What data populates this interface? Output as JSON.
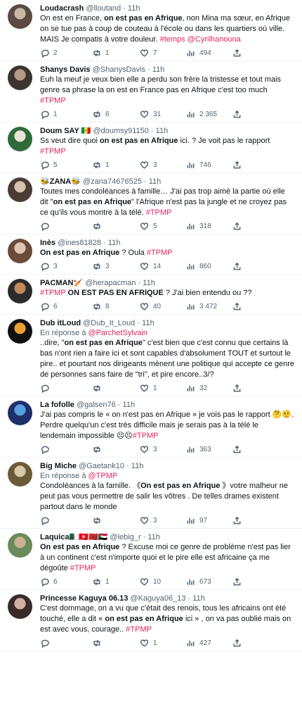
{
  "colors": {
    "hashtag": "#e0245e",
    "meta": "#536471",
    "text": "#0f1419",
    "divider": "#eff3f4"
  },
  "icons": {
    "reply": "speech-bubble-icon",
    "retweet": "retweet-icon",
    "like": "heart-icon",
    "views": "bar-chart-icon",
    "share": "share-icon"
  },
  "tweets": [
    {
      "name": "Loudacrash",
      "meta": "@lloutand · 11h",
      "segments": [
        {
          "t": "On est en France, "
        },
        {
          "t": "on est pas en Afrique",
          "b": true
        },
        {
          "t": ", non Mina ma sœur, en Afrique on se tue pas à coup de couteau à l'école ou dans les quartiers où ville. MAIS Je compatis à votre douleur. "
        },
        {
          "t": "#temps",
          "h": true
        },
        {
          "t": " "
        },
        {
          "t": "@Cyrilhanouna",
          "h": true
        }
      ],
      "stats": {
        "reply": "2",
        "retweet": "1",
        "like": "7",
        "views": "494"
      }
    },
    {
      "name": "Shanys Davis",
      "meta": "@ShanysDavis · 11h",
      "segments": [
        {
          "t": "Euh la meuf je veux bien elle a perdu son frère la tristesse et tout mais genre sa phrase la on est en France pas en Afrique c'est too much "
        },
        {
          "t": "#TPMP",
          "h": true
        }
      ],
      "stats": {
        "reply": "1",
        "retweet": "6",
        "like": "31",
        "views": "2 365"
      }
    },
    {
      "name": "Doum SAY 🇸🇳",
      "meta": "@doumsy91150 · 11h",
      "segments": [
        {
          "t": "Ss veut dire quoi "
        },
        {
          "t": "on est pas en Afrique",
          "b": true
        },
        {
          "t": " ici. ? Je voit pas le rapport  "
        },
        {
          "t": "#TPMP",
          "h": true
        }
      ],
      "stats": {
        "reply": "5",
        "retweet": "1",
        "like": "3",
        "views": "746"
      }
    },
    {
      "name": "🐝ZANA🐝",
      "meta": "@zana74676525 · 11h",
      "segments": [
        {
          "t": "Toutes mes condoléances à famille… J'ai pas trop aimé la partie où elle dit \""
        },
        {
          "t": "on est pas en Afrique",
          "b": true
        },
        {
          "t": "\" l'Afrique n'est pas la jungle et ne croyez pas ce qu'ils vous montre à la télé.  "
        },
        {
          "t": "#TPMP",
          "h": true
        }
      ],
      "stats": {
        "reply": "",
        "retweet": "",
        "like": "5",
        "views": "318"
      }
    },
    {
      "name": "Inès",
      "meta": "@ines81828 · 11h",
      "segments": [
        {
          "t": "On est pas en Afrique",
          "b": true
        },
        {
          "t": " ? Oula "
        },
        {
          "t": "#TPMP",
          "h": true
        }
      ],
      "stats": {
        "reply": "3",
        "retweet": "3",
        "like": "14",
        "views": "860"
      }
    },
    {
      "name": "PACMAN🏏",
      "meta": "@herapacman · 11h",
      "segments": [
        {
          "t": "#TPMP",
          "h": true
        },
        {
          "t": "  "
        },
        {
          "t": "ON EST PAS EN AFRIQUE",
          "b": true
        },
        {
          "t": " ? J'ai bien entendu ou ??"
        }
      ],
      "stats": {
        "reply": "6",
        "retweet": "8",
        "like": "40",
        "views": "3 472"
      }
    },
    {
      "name": "Dub itLoud",
      "meta": "@Dub_It_Loud · 11h",
      "reply_prefix": "En réponse à ",
      "reply_to": "@ParchetSylvain",
      "segments": [
        {
          "t": "..dire, \""
        },
        {
          "t": "on est pas en Afrique",
          "b": true
        },
        {
          "t": "\" c'est bien que c'est connu que certains là bas n'ont rien a faire ici et sont capables d'absolument TOUT et surtout le pire.. et pourtant nos dirigeants mènent une politique qui accepte ce genre de personnes sans faire de \"tri\", et pire encore..3/?"
        }
      ],
      "stats": {
        "reply": "",
        "retweet": "",
        "like": "1",
        "views": "32"
      }
    },
    {
      "name": "La fofolle",
      "meta": "@galsen76 · 11h",
      "segments": [
        {
          "t": "J'ai pas compris le « on n'est pas en Afrique » je vois pas le rapport 🤔🤨. Perdre quelqu'un c'est très difficile mais je serais pas à la télé le lendemain impossible 😣😣"
        },
        {
          "t": "#TPMP",
          "h": true
        }
      ],
      "stats": {
        "reply": "",
        "retweet": "",
        "like": "3",
        "views": "363"
      }
    },
    {
      "name": "Big Miche",
      "meta": "@Gaetank10 · 11h",
      "reply_prefix": "En réponse à ",
      "reply_to": "@TPMP",
      "segments": [
        {
          "t": "Condoléances à la famille. 《"
        },
        {
          "t": "On est pas en Afrique",
          "b": true
        },
        {
          "t": " 》votre malheur ne peut pas vous permettre de salir les vôtres .  De telles drames existent partout dans le monde"
        }
      ],
      "stats": {
        "reply": "",
        "retweet": "",
        "like": "3",
        "views": "97"
      }
    },
    {
      "name": "Laquica🇩🇿🇹🇳🇲🇦🇸🇩",
      "meta": "@lebig_r · 11h",
      "segments": [
        {
          "t": "On est pas en Afrique",
          "b": true
        },
        {
          "t": " ? Excuse moi ce genre de problème n'est pas lier à un continent c'est n'importe quoi et le pire elle est africaine ça me dégoûte "
        },
        {
          "t": "#TPMP",
          "h": true
        }
      ],
      "stats": {
        "reply": "6",
        "retweet": "1",
        "like": "10",
        "views": "673"
      }
    },
    {
      "name": "Princesse Kaguya 06.13",
      "meta": "@Kaguya06_13 · 11h",
      "segments": [
        {
          "t": "C'est dommage, on a vu que c'était des renois, tous les africains ont été touché, elle a dit « "
        },
        {
          "t": "on est pas en Afrique",
          "b": true
        },
        {
          "t": " ici » , on va pas oublié mais on est avec vous, courage.. "
        },
        {
          "t": "#TPMP",
          "h": true
        }
      ],
      "stats": {
        "reply": "",
        "retweet": "",
        "like": "1",
        "views": "427"
      }
    }
  ]
}
